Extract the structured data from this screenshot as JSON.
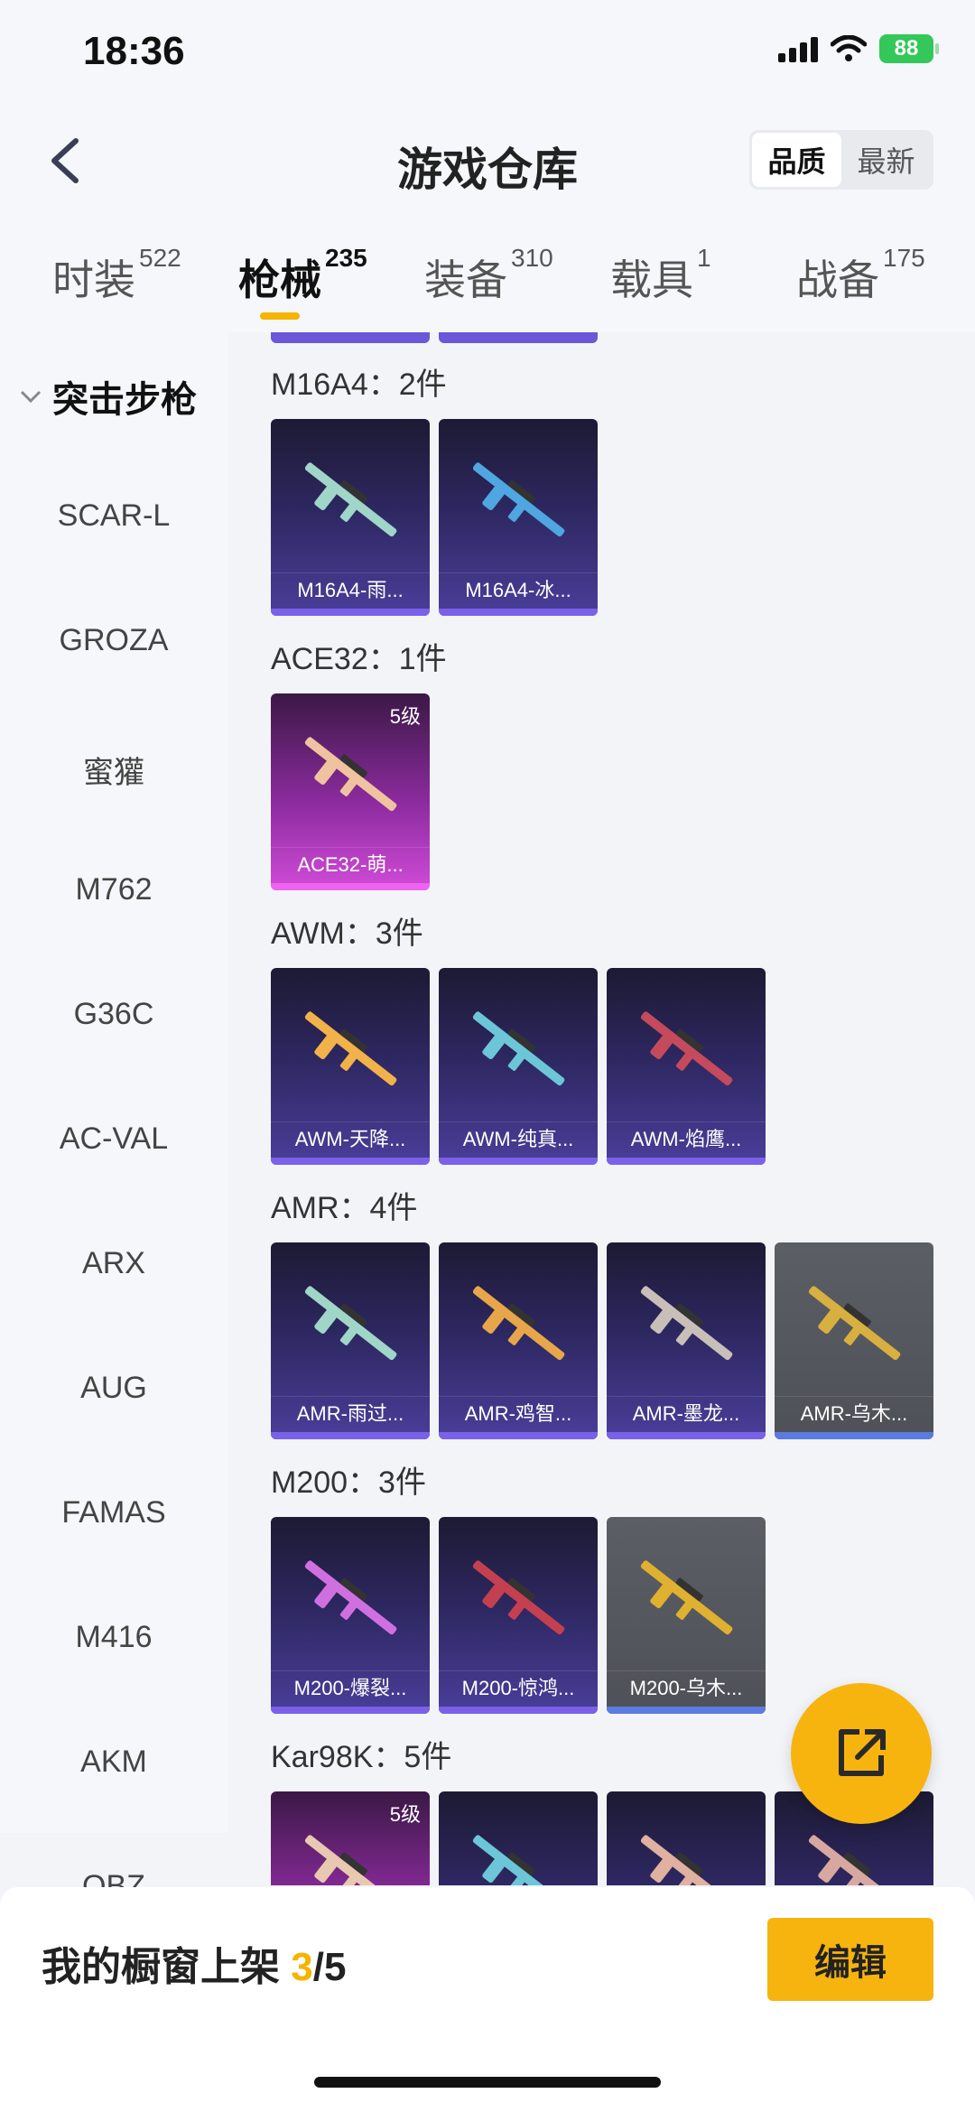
{
  "status": {
    "time": "18:36",
    "battery": "88"
  },
  "header": {
    "title": "游戏仓库",
    "sort": [
      "品质",
      "最新"
    ]
  },
  "tabs": [
    {
      "label": "时装",
      "count": "522"
    },
    {
      "label": "枪械",
      "count": "235"
    },
    {
      "label": "装备",
      "count": "310"
    },
    {
      "label": "载具",
      "count": "1"
    },
    {
      "label": "战备",
      "count": "175"
    }
  ],
  "sidebar": {
    "category": "突击步枪",
    "items": [
      "SCAR-L",
      "GROZA",
      "蜜獾",
      "M762",
      "G36C",
      "AC-VAL",
      "ARX",
      "AUG",
      "FAMAS",
      "M416",
      "AKM",
      "QBZ"
    ]
  },
  "sections": [
    {
      "title": "M16A4：2件",
      "items": [
        {
          "name": "M16A4-雨...",
          "style": "purple"
        },
        {
          "name": "M16A4-冰...",
          "style": "purple"
        }
      ]
    },
    {
      "title": "ACE32：1件",
      "items": [
        {
          "name": "ACE32-萌...",
          "style": "pink",
          "level": "5级"
        }
      ]
    },
    {
      "title": "AWM：3件",
      "items": [
        {
          "name": "AWM-天降...",
          "style": "purple"
        },
        {
          "name": "AWM-纯真...",
          "style": "purple"
        },
        {
          "name": "AWM-焰鹰...",
          "style": "purple"
        }
      ]
    },
    {
      "title": "AMR：4件",
      "items": [
        {
          "name": "AMR-雨过...",
          "style": "purple"
        },
        {
          "name": "AMR-鸡智...",
          "style": "purple"
        },
        {
          "name": "AMR-墨龙...",
          "style": "purple"
        },
        {
          "name": "AMR-乌木...",
          "style": "gray"
        }
      ]
    },
    {
      "title": "M200：3件",
      "items": [
        {
          "name": "M200-爆裂...",
          "style": "purple"
        },
        {
          "name": "M200-惊鸿...",
          "style": "purple"
        },
        {
          "name": "M200-乌木...",
          "style": "gray"
        }
      ]
    },
    {
      "title": "Kar98K：5件",
      "items": [
        {
          "name": "",
          "style": "pink",
          "level": "5级"
        },
        {
          "name": "",
          "style": "purple"
        },
        {
          "name": "",
          "style": "purple"
        },
        {
          "name": "",
          "style": "purple"
        }
      ]
    }
  ],
  "bottom": {
    "label": "我的橱窗上架 ",
    "current": "3",
    "total": "/5",
    "edit": "编辑"
  },
  "colors": {
    "accent": "#f7b40f",
    "purple": "#4a3e9a",
    "pink": "#d14bd8",
    "gray": "#5c5e66"
  }
}
